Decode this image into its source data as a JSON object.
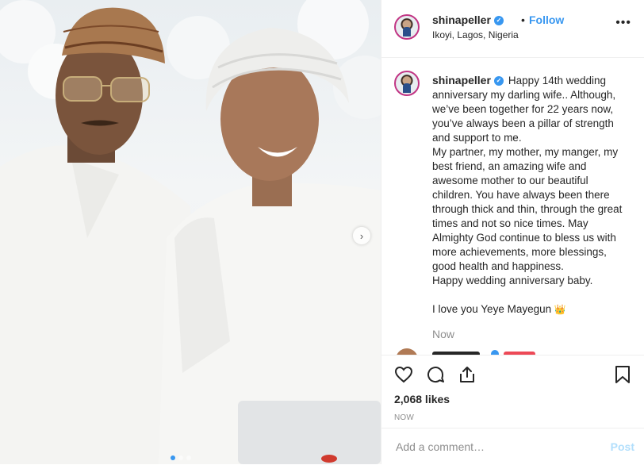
{
  "post": {
    "username": "shinapeller",
    "follow_label": "Follow",
    "separator": "•",
    "location": "Ikoyi, Lagos, Nigeria",
    "more_icon": "more-options-icon"
  },
  "caption": {
    "username": "shinapeller",
    "text": "Happy 14th wedding anniversary my darling wife.. Although, we’ve been together for 22 years now, you’ve always been a pillar of strength and support to me.\nMy partner, my mother, my manger, my best friend, an amazing wife and awesome mother to our beautiful children. You have always been there through thick and thin, through the great times and not so nice times. May Almighty God continue to bless us with more achievements, more blessings, good health and happiness.\nHappy wedding anniversary baby.\n\nI love you Yeye Mayegun ",
    "emoji": "👑",
    "time": "Now"
  },
  "actions": {
    "likes": "2,068 likes",
    "posted": "NOW"
  },
  "comment_box": {
    "placeholder": "Add a comment…",
    "post_label": "Post"
  },
  "carousel": {
    "total": 3,
    "active": 0
  },
  "colors": {
    "accent": "#3897f0",
    "verified": "#3897f0",
    "post_disabled": "#b2dffc"
  }
}
